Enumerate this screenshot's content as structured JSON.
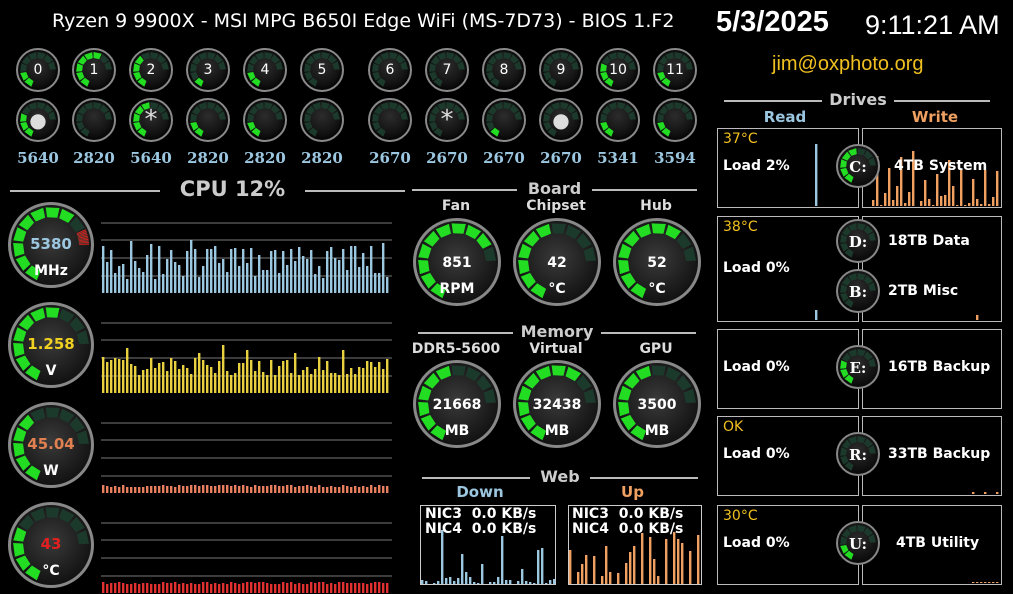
{
  "header": {
    "title": "Ryzen 9 9900X - MSI MPG B650I Edge WiFi (MS-7D73) - BIOS 1.F2",
    "date": "5/3/2025",
    "time": "9:11:21 AM",
    "email": "jim@oxphoto.org"
  },
  "cores": {
    "labels": [
      "0",
      "1",
      "2",
      "3",
      "4",
      "5",
      "6",
      "7",
      "8",
      "9",
      "10",
      "11"
    ],
    "load_top": [
      2,
      6,
      4,
      1,
      2,
      0,
      0,
      0,
      0,
      0,
      3,
      2
    ],
    "load_bottom": [
      3,
      0,
      5,
      2,
      2,
      0,
      0,
      0,
      1,
      0,
      2,
      2
    ],
    "bottom_symbols": [
      "●",
      "",
      "*",
      "",
      "",
      "",
      "",
      "*",
      "",
      "●",
      "",
      ""
    ],
    "freqs": [
      "5640",
      "2820",
      "5640",
      "2820",
      "2820",
      "2820",
      "2670",
      "2670",
      "2670",
      "2670",
      "5341",
      "3594"
    ]
  },
  "cpu": {
    "header": "CPU  12%",
    "gauges": [
      {
        "value": "5380",
        "unit": "MHz",
        "color": "#9cc7e0",
        "level": 8,
        "redTip": true
      },
      {
        "value": "1.258",
        "unit": "V",
        "color": "#f0d020",
        "level": 7,
        "redTip": false
      },
      {
        "value": "45.04",
        "unit": "W",
        "color": "#e08050",
        "level": 5,
        "redTip": false
      },
      {
        "value": "43",
        "unit": "°C",
        "color": "#e02020",
        "level": 4,
        "redTip": false
      }
    ],
    "graph_colors": [
      "#9cc7e0",
      "#e8d040",
      "#e88060",
      "#e03030"
    ]
  },
  "board": {
    "header": "Board",
    "labels": [
      "Fan",
      "Chipset",
      "Hub"
    ],
    "values": [
      "851",
      "42",
      "52"
    ],
    "units": [
      "RPM",
      "°C",
      "°C"
    ],
    "levels": [
      9,
      6,
      8
    ]
  },
  "memory": {
    "header": "Memory",
    "labels": [
      "DDR5-5600",
      "Virtual",
      "GPU"
    ],
    "values": [
      "21668",
      "32438",
      "3500"
    ],
    "units": [
      "MB",
      "MB",
      "MB"
    ],
    "levels": [
      6,
      8,
      6
    ]
  },
  "web": {
    "header": "Web",
    "down_label": "Down",
    "up_label": "Up",
    "down_lines": [
      "NIC3  0.0 KB/s",
      "NIC4  0.0 KB/s"
    ],
    "up_lines": [
      "NIC3  0.0 KB/s",
      "NIC4  0.0 KB/s"
    ]
  },
  "drives": {
    "header": "Drives",
    "read_label": "Read",
    "write_label": "Write",
    "items": [
      {
        "temp": "37°C",
        "load": "Load 2%",
        "letters": [
          {
            "l": "C:",
            "name": "4TB System",
            "color": "#fff",
            "level": 5
          }
        ]
      },
      {
        "temp": "38°C",
        "load": "Load 0%",
        "letters": [
          {
            "l": "D:",
            "name": "18TB Data",
            "color": "#fff",
            "level": 0
          },
          {
            "l": "B:",
            "name": "2TB Misc",
            "color": "#fff",
            "level": 0
          }
        ]
      },
      {
        "temp": "",
        "load": "Load 0%",
        "letters": [
          {
            "l": "E:",
            "name": "16TB Backup",
            "color": "#fff",
            "level": 3
          }
        ]
      },
      {
        "temp": "OK",
        "load": "Load 0%",
        "letters": [
          {
            "l": "R:",
            "name": "33TB Backup",
            "color": "#fff",
            "level": 0
          }
        ]
      },
      {
        "temp": "30°C",
        "load": "Load 0%",
        "letters": [
          {
            "l": "U:",
            "name": "4TB Utility",
            "color": "#fff",
            "level": 2
          }
        ]
      }
    ]
  }
}
